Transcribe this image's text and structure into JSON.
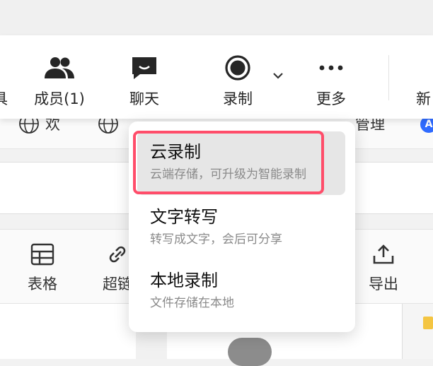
{
  "toolbar": {
    "edge_left_label": "具",
    "members_label": "成员(1)",
    "chat_label": "聊天",
    "record_label": "录制",
    "more_label": "更多",
    "new_label": "新"
  },
  "background": {
    "chip1_label": "欢",
    "chip3_label": "管理",
    "blue_badge": "A",
    "table_label": "表格",
    "link_label": "超链",
    "export_label": "导出"
  },
  "record_menu": {
    "items": [
      {
        "title": "云录制",
        "subtitle": "云端存储，可升级为智能录制"
      },
      {
        "title": "文字转写",
        "subtitle": "转写成文字，会后可分享"
      },
      {
        "title": "本地录制",
        "subtitle": "文件存储在本地"
      }
    ]
  },
  "colors": {
    "highlight": "#ff4d6a",
    "active_item_bg": "#e6e6e6",
    "icon_dark": "#262626"
  }
}
